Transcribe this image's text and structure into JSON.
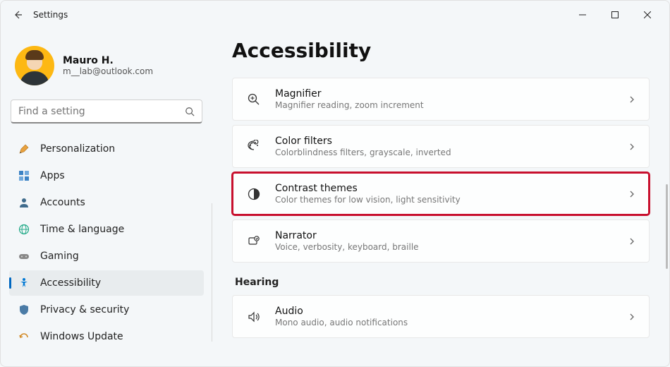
{
  "titlebar": {
    "title": "Settings"
  },
  "profile": {
    "name": "Mauro H.",
    "email": "m__lab@outlook.com"
  },
  "search": {
    "placeholder": "Find a setting"
  },
  "sidebar": {
    "items": [
      {
        "label": "Personalization",
        "icon": "personalization-icon",
        "active": false
      },
      {
        "label": "Apps",
        "icon": "apps-icon",
        "active": false
      },
      {
        "label": "Accounts",
        "icon": "accounts-icon",
        "active": false
      },
      {
        "label": "Time & language",
        "icon": "time-language-icon",
        "active": false
      },
      {
        "label": "Gaming",
        "icon": "gaming-icon",
        "active": false
      },
      {
        "label": "Accessibility",
        "icon": "accessibility-icon",
        "active": true
      },
      {
        "label": "Privacy & security",
        "icon": "privacy-icon",
        "active": false
      },
      {
        "label": "Windows Update",
        "icon": "update-icon",
        "active": false
      }
    ]
  },
  "main": {
    "title": "Accessibility",
    "cards": [
      {
        "title": "Magnifier",
        "subtitle": "Magnifier reading, zoom increment",
        "icon": "magnifier-icon",
        "highlight": false
      },
      {
        "title": "Color filters",
        "subtitle": "Colorblindness filters, grayscale, inverted",
        "icon": "color-filters-icon",
        "highlight": false
      },
      {
        "title": "Contrast themes",
        "subtitle": "Color themes for low vision, light sensitivity",
        "icon": "contrast-icon",
        "highlight": true
      },
      {
        "title": "Narrator",
        "subtitle": "Voice, verbosity, keyboard, braille",
        "icon": "narrator-icon",
        "highlight": false
      }
    ],
    "section_heading": "Hearing",
    "cards2": [
      {
        "title": "Audio",
        "subtitle": "Mono audio, audio notifications",
        "icon": "audio-icon",
        "highlight": false
      }
    ]
  }
}
